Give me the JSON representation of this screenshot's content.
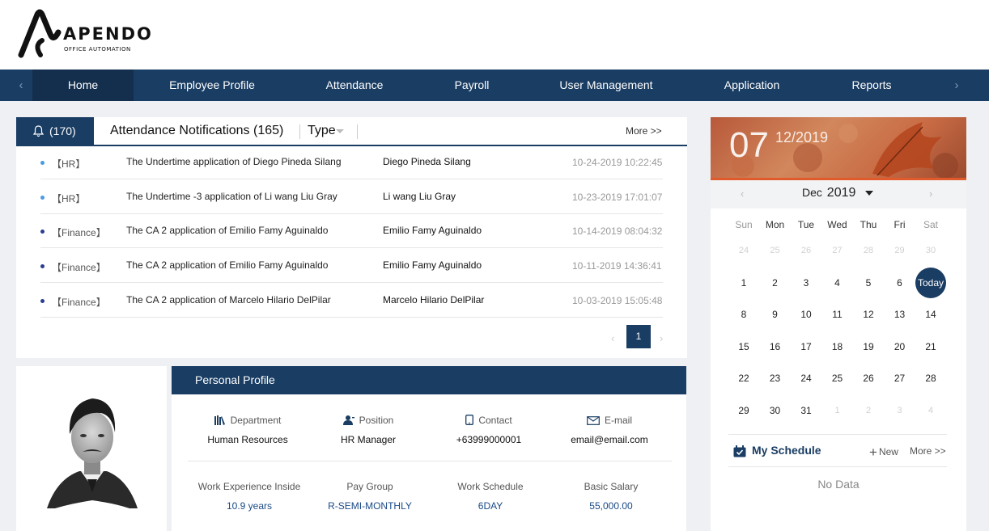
{
  "brand": {
    "name": "APENDO",
    "tagline": "OFFICE AUTOMATION"
  },
  "nav": {
    "prev_arrow": "‹",
    "next_arrow": "›",
    "items": [
      {
        "label": "Home",
        "active": true
      },
      {
        "label": "Employee Profile"
      },
      {
        "label": "Attendance"
      },
      {
        "label": "Payroll"
      },
      {
        "label": "User Management"
      },
      {
        "label": "Application"
      },
      {
        "label": "Reports"
      }
    ]
  },
  "notifications": {
    "bell_count": "(170)",
    "title": "Attendance Notifications (165)",
    "type_filter": "Type",
    "more": "More >>",
    "rows": [
      {
        "category": "【HR】",
        "subject": "The Undertime application of Diego Pineda Silang",
        "name": "Diego Pineda Silang",
        "time": "10-24-2019 10:22:45",
        "dot_color": "#4a9be0"
      },
      {
        "category": "【HR】",
        "subject": "The Undertime -3 application of Li wang Liu Gray",
        "name": "Li wang Liu Gray",
        "time": "10-23-2019 17:01:07",
        "dot_color": "#4a9be0"
      },
      {
        "category": "【Finance】",
        "subject": "The CA 2 application of Emilio Famy Aguinaldo",
        "name": "Emilio Famy Aguinaldo",
        "time": "10-14-2019 08:04:32",
        "dot_color": "#2b3d8f"
      },
      {
        "category": "【Finance】",
        "subject": "The CA 2 application of Emilio Famy Aguinaldo",
        "name": "Emilio Famy Aguinaldo",
        "time": "10-11-2019 14:36:41",
        "dot_color": "#2b3d8f"
      },
      {
        "category": "【Finance】",
        "subject": "The CA 2 application of Marcelo Hilario DelPilar",
        "name": "Marcelo Hilario DelPilar",
        "time": "10-03-2019 15:05:48",
        "dot_color": "#2b3d8f"
      }
    ],
    "pagination": {
      "prev": "‹",
      "current": "1",
      "next": "›"
    }
  },
  "profile": {
    "title": "Personal Profile",
    "top": [
      {
        "label": "Department",
        "value": "Human Resources",
        "icon": "books-icon"
      },
      {
        "label": "Position",
        "value": "HR Manager",
        "icon": "person-icon"
      },
      {
        "label": "Contact",
        "value": "+63999000001",
        "icon": "phone-icon"
      },
      {
        "label": "E-mail",
        "value": "email@email.com",
        "icon": "mail-icon"
      }
    ],
    "bottom": [
      {
        "label": "Work Experience Inside",
        "value": "10.9 years"
      },
      {
        "label": "Pay Group",
        "value": "R-SEMI-MONTHLY"
      },
      {
        "label": "Work Schedule",
        "value": "6DAY"
      },
      {
        "label": "Basic Salary",
        "value": "55,000.00"
      }
    ]
  },
  "calendar": {
    "banner_day": "07",
    "banner_month_year": "12/2019",
    "month": "Dec",
    "year": "2019",
    "prev": "‹",
    "next": "›",
    "weekdays": [
      "Sun",
      "Mon",
      "Tue",
      "Wed",
      "Thu",
      "Fri",
      "Sat"
    ],
    "weeks": [
      [
        "24",
        "25",
        "26",
        "27",
        "28",
        "29",
        "30"
      ],
      [
        "1",
        "2",
        "3",
        "4",
        "5",
        "6",
        "Today"
      ],
      [
        "8",
        "9",
        "10",
        "11",
        "12",
        "13",
        "14"
      ],
      [
        "15",
        "16",
        "17",
        "18",
        "19",
        "20",
        "21"
      ],
      [
        "22",
        "23",
        "24",
        "25",
        "26",
        "27",
        "28"
      ],
      [
        "29",
        "30",
        "31",
        "1",
        "2",
        "3",
        "4"
      ]
    ],
    "muted": [
      [
        true,
        true,
        true,
        true,
        true,
        true,
        true
      ],
      [
        false,
        false,
        false,
        false,
        false,
        false,
        false
      ],
      [
        false,
        false,
        false,
        false,
        false,
        false,
        false
      ],
      [
        false,
        false,
        false,
        false,
        false,
        false,
        false
      ],
      [
        false,
        false,
        false,
        false,
        false,
        false,
        false
      ],
      [
        false,
        false,
        false,
        true,
        true,
        true,
        true
      ]
    ]
  },
  "schedule": {
    "title": "My Schedule",
    "new_label": "New",
    "new_plus": "+",
    "more": "More >>",
    "empty": "No Data"
  },
  "colors": {
    "primary": "#1a3d63",
    "accent_orange": "#e05a2c"
  }
}
